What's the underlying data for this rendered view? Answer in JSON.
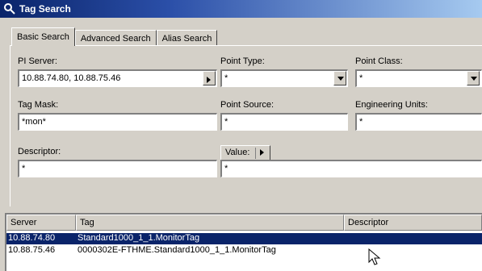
{
  "window": {
    "title": "Tag Search"
  },
  "tabs": [
    {
      "label": "Basic Search",
      "active": true
    },
    {
      "label": "Advanced Search",
      "active": false
    },
    {
      "label": "Alias Search",
      "active": false
    }
  ],
  "form": {
    "pi_server": {
      "label": "PI Server:",
      "value": "10.88.74.80, 10.88.75.46"
    },
    "point_type": {
      "label": "Point Type:",
      "value": "*"
    },
    "point_class": {
      "label": "Point Class:",
      "value": "*"
    },
    "tag_mask": {
      "label": "Tag Mask:",
      "value": "*mon*"
    },
    "point_source": {
      "label": "Point Source:",
      "value": "*"
    },
    "engineering_units": {
      "label": "Engineering Units:",
      "value": "*"
    },
    "descriptor": {
      "label": "Descriptor:",
      "value": "*"
    },
    "value": {
      "label": "Value:",
      "value": "*"
    }
  },
  "results": {
    "columns": [
      "Server",
      "Tag",
      "Descriptor"
    ],
    "rows": [
      {
        "server": "10.88.74.80",
        "tag": "Standard1000_1_1.MonitorTag",
        "descriptor": "",
        "selected": true
      },
      {
        "server": "10.88.75.46",
        "tag": "0000302E-FTHME.Standard1000_1_1.MonitorTag",
        "descriptor": "",
        "selected": false
      }
    ]
  },
  "colors": {
    "title_bar": "#0a246a",
    "selection": "#0a246a",
    "face": "#d4d0c8"
  }
}
